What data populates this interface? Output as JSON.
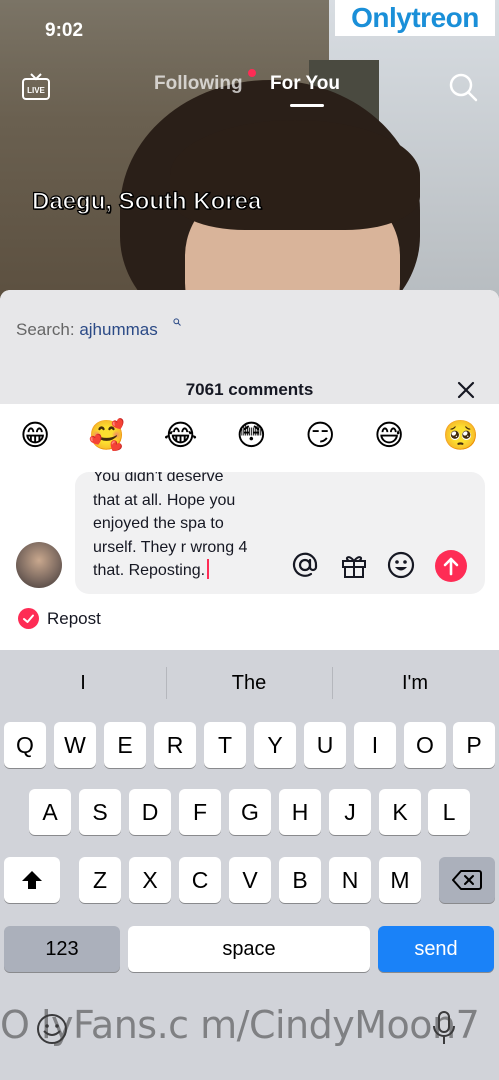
{
  "status": {
    "time": "9:02"
  },
  "watermark_top": {
    "part1": "Only",
    "part2": "treon"
  },
  "nav": {
    "live_label": "LIVE",
    "tab_following": "Following",
    "tab_for_you": "For You"
  },
  "video": {
    "location": "Daegu, South Korea"
  },
  "comments": {
    "search_label": "Search:",
    "search_query": "ajhummas",
    "count_label": "7061 comments",
    "emojis": [
      "😁",
      "🥰",
      "😂",
      "😳",
      "😏",
      "😅",
      "🥺"
    ],
    "draft_lines": [
      "You didn't deserve",
      "that at all. Hope you",
      "enjoyed the spa to",
      "urself. They r wrong 4",
      "that. Reposting."
    ],
    "repost_label": "Repost"
  },
  "keyboard": {
    "suggestions": [
      "I",
      "The",
      "I'm"
    ],
    "row1": [
      "Q",
      "W",
      "E",
      "R",
      "T",
      "Y",
      "U",
      "I",
      "O",
      "P"
    ],
    "row2": [
      "A",
      "S",
      "D",
      "F",
      "G",
      "H",
      "J",
      "K",
      "L"
    ],
    "row3": [
      "Z",
      "X",
      "C",
      "V",
      "B",
      "N",
      "M"
    ],
    "numbers_label": "123",
    "space_label": "space",
    "send_label": "send"
  },
  "watermark_bottom": "O lyFans.c m/CindyMoon7"
}
